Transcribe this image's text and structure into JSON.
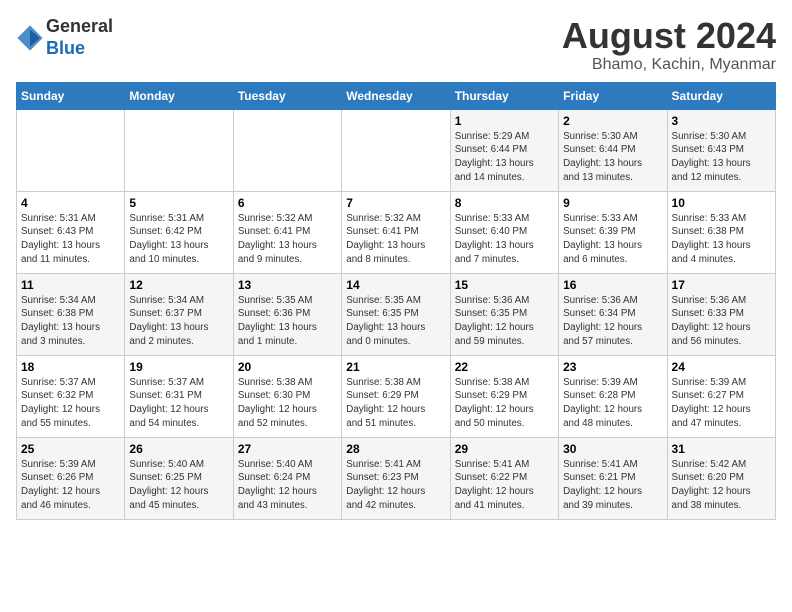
{
  "logo": {
    "general": "General",
    "blue": "Blue"
  },
  "title": {
    "month_year": "August 2024",
    "location": "Bhamo, Kachin, Myanmar"
  },
  "days_of_week": [
    "Sunday",
    "Monday",
    "Tuesday",
    "Wednesday",
    "Thursday",
    "Friday",
    "Saturday"
  ],
  "weeks": [
    [
      {
        "day": "",
        "info": ""
      },
      {
        "day": "",
        "info": ""
      },
      {
        "day": "",
        "info": ""
      },
      {
        "day": "",
        "info": ""
      },
      {
        "day": "1",
        "info": "Sunrise: 5:29 AM\nSunset: 6:44 PM\nDaylight: 13 hours\nand 14 minutes."
      },
      {
        "day": "2",
        "info": "Sunrise: 5:30 AM\nSunset: 6:44 PM\nDaylight: 13 hours\nand 13 minutes."
      },
      {
        "day": "3",
        "info": "Sunrise: 5:30 AM\nSunset: 6:43 PM\nDaylight: 13 hours\nand 12 minutes."
      }
    ],
    [
      {
        "day": "4",
        "info": "Sunrise: 5:31 AM\nSunset: 6:43 PM\nDaylight: 13 hours\nand 11 minutes."
      },
      {
        "day": "5",
        "info": "Sunrise: 5:31 AM\nSunset: 6:42 PM\nDaylight: 13 hours\nand 10 minutes."
      },
      {
        "day": "6",
        "info": "Sunrise: 5:32 AM\nSunset: 6:41 PM\nDaylight: 13 hours\nand 9 minutes."
      },
      {
        "day": "7",
        "info": "Sunrise: 5:32 AM\nSunset: 6:41 PM\nDaylight: 13 hours\nand 8 minutes."
      },
      {
        "day": "8",
        "info": "Sunrise: 5:33 AM\nSunset: 6:40 PM\nDaylight: 13 hours\nand 7 minutes."
      },
      {
        "day": "9",
        "info": "Sunrise: 5:33 AM\nSunset: 6:39 PM\nDaylight: 13 hours\nand 6 minutes."
      },
      {
        "day": "10",
        "info": "Sunrise: 5:33 AM\nSunset: 6:38 PM\nDaylight: 13 hours\nand 4 minutes."
      }
    ],
    [
      {
        "day": "11",
        "info": "Sunrise: 5:34 AM\nSunset: 6:38 PM\nDaylight: 13 hours\nand 3 minutes."
      },
      {
        "day": "12",
        "info": "Sunrise: 5:34 AM\nSunset: 6:37 PM\nDaylight: 13 hours\nand 2 minutes."
      },
      {
        "day": "13",
        "info": "Sunrise: 5:35 AM\nSunset: 6:36 PM\nDaylight: 13 hours\nand 1 minute."
      },
      {
        "day": "14",
        "info": "Sunrise: 5:35 AM\nSunset: 6:35 PM\nDaylight: 13 hours\nand 0 minutes."
      },
      {
        "day": "15",
        "info": "Sunrise: 5:36 AM\nSunset: 6:35 PM\nDaylight: 12 hours\nand 59 minutes."
      },
      {
        "day": "16",
        "info": "Sunrise: 5:36 AM\nSunset: 6:34 PM\nDaylight: 12 hours\nand 57 minutes."
      },
      {
        "day": "17",
        "info": "Sunrise: 5:36 AM\nSunset: 6:33 PM\nDaylight: 12 hours\nand 56 minutes."
      }
    ],
    [
      {
        "day": "18",
        "info": "Sunrise: 5:37 AM\nSunset: 6:32 PM\nDaylight: 12 hours\nand 55 minutes."
      },
      {
        "day": "19",
        "info": "Sunrise: 5:37 AM\nSunset: 6:31 PM\nDaylight: 12 hours\nand 54 minutes."
      },
      {
        "day": "20",
        "info": "Sunrise: 5:38 AM\nSunset: 6:30 PM\nDaylight: 12 hours\nand 52 minutes."
      },
      {
        "day": "21",
        "info": "Sunrise: 5:38 AM\nSunset: 6:29 PM\nDaylight: 12 hours\nand 51 minutes."
      },
      {
        "day": "22",
        "info": "Sunrise: 5:38 AM\nSunset: 6:29 PM\nDaylight: 12 hours\nand 50 minutes."
      },
      {
        "day": "23",
        "info": "Sunrise: 5:39 AM\nSunset: 6:28 PM\nDaylight: 12 hours\nand 48 minutes."
      },
      {
        "day": "24",
        "info": "Sunrise: 5:39 AM\nSunset: 6:27 PM\nDaylight: 12 hours\nand 47 minutes."
      }
    ],
    [
      {
        "day": "25",
        "info": "Sunrise: 5:39 AM\nSunset: 6:26 PM\nDaylight: 12 hours\nand 46 minutes."
      },
      {
        "day": "26",
        "info": "Sunrise: 5:40 AM\nSunset: 6:25 PM\nDaylight: 12 hours\nand 45 minutes."
      },
      {
        "day": "27",
        "info": "Sunrise: 5:40 AM\nSunset: 6:24 PM\nDaylight: 12 hours\nand 43 minutes."
      },
      {
        "day": "28",
        "info": "Sunrise: 5:41 AM\nSunset: 6:23 PM\nDaylight: 12 hours\nand 42 minutes."
      },
      {
        "day": "29",
        "info": "Sunrise: 5:41 AM\nSunset: 6:22 PM\nDaylight: 12 hours\nand 41 minutes."
      },
      {
        "day": "30",
        "info": "Sunrise: 5:41 AM\nSunset: 6:21 PM\nDaylight: 12 hours\nand 39 minutes."
      },
      {
        "day": "31",
        "info": "Sunrise: 5:42 AM\nSunset: 6:20 PM\nDaylight: 12 hours\nand 38 minutes."
      }
    ]
  ]
}
